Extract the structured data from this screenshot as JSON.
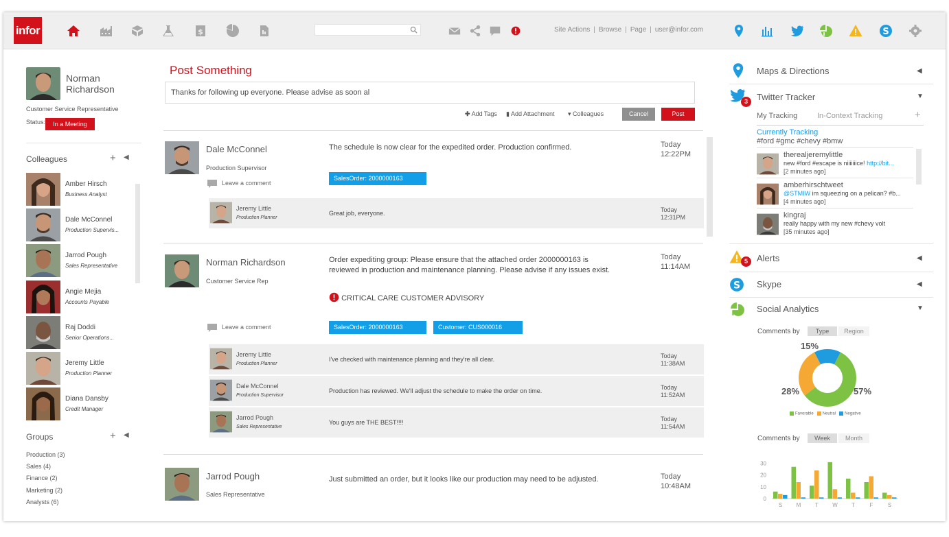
{
  "app": {
    "logo": "infor"
  },
  "topbar": {
    "search": {
      "value": "",
      "placeholder": ""
    },
    "site_links": [
      "Site Actions",
      "Browse",
      "Page",
      "user@infor.com"
    ]
  },
  "profile": {
    "name": "Norman Richardson",
    "title": "Customer Service Representative",
    "status_label": "Status:",
    "status": "In a Meeting"
  },
  "colleagues": {
    "title": "Colleagues",
    "items": [
      {
        "name": "Amber Hirsch",
        "role": "Business Analyst"
      },
      {
        "name": "Dale McConnel",
        "role": "Production Supervis..."
      },
      {
        "name": "Jarrod Pough",
        "role": "Sales Representative"
      },
      {
        "name": "Angie Mejia",
        "role": "Accounts Payable"
      },
      {
        "name": "Raj Doddi",
        "role": "Senior Operations..."
      },
      {
        "name": "Jeremy Little",
        "role": "Production Planner"
      },
      {
        "name": "Diana Dansby",
        "role": "Credit Manager"
      }
    ]
  },
  "groups": {
    "title": "Groups",
    "items": [
      "Production (3)",
      "Sales (4)",
      "Finance (2)",
      "Marketing (2)",
      "Analysts (6)"
    ]
  },
  "composer": {
    "title": "Post Something",
    "text": "Thanks for following up everyone. Please advise as soon al",
    "add_tags": "Add Tags",
    "add_attachment": "Add Attachment",
    "colleagues": "Colleagues",
    "cancel": "Cancel",
    "post": "Post"
  },
  "posts": [
    {
      "name": "Dale McConnel",
      "role": "Production Supervisor",
      "body": "The schedule is now clear for the expedited order. Production confirmed.",
      "day": "Today",
      "time": "12:22PM",
      "comment": "Leave a comment",
      "tags": [
        "SalesOrder: 2000000163"
      ],
      "replies": [
        {
          "name": "Jeremy Little",
          "role": "Production Planner",
          "text": "Great job, everyone.",
          "day": "Today",
          "time": "12:31PM"
        }
      ]
    },
    {
      "name": "Norman Richardson",
      "role": "Customer Service Rep",
      "body": "Order expediting group: Please ensure that the attached order 2000000163 is reviewed in production and maintenance planning. Please advise if any issues exist.",
      "critical": "CRITICAL CARE CUSTOMER ADVISORY",
      "day": "Today",
      "time": "11:14AM",
      "comment": "Leave a comment",
      "tags": [
        "SalesOrder: 2000000163",
        "Customer: CUS000016"
      ],
      "replies": [
        {
          "name": "Jeremy Little",
          "role": "Production Planner",
          "text": "I've checked with maintenance planning and they're all clear.",
          "day": "Today",
          "time": "11:38AM"
        },
        {
          "name": "Dale McConnel",
          "role": "Production Supervisor",
          "text": "Production has reviewed. We'll adjust the schedule to make the order on time.",
          "day": "Today",
          "time": "11:52AM"
        },
        {
          "name": "Jarrod Pough",
          "role": "Sales Representative",
          "text": "You guys are THE BEST!!!!",
          "day": "Today",
          "time": "11:54AM"
        }
      ]
    },
    {
      "name": "Jarrod Pough",
      "role": "Sales Representative",
      "body": "Just submitted an order, but it looks like our production may need to be adjusted.",
      "day": "Today",
      "time": "10:48AM"
    }
  ],
  "right": {
    "maps": "Maps & Directions",
    "twitter": {
      "title": "Twitter Tracker",
      "badge": "3",
      "tab_active": "My Tracking",
      "tab_other": "In-Context Tracking",
      "currently": "Currently Tracking",
      "hashtags": "#ford  #gmc  #chevy  #bmw",
      "tweets": [
        {
          "user": "therealjeremylittle",
          "text": "new #ford #escape is niiiiiiice!",
          "link": "http://bit...",
          "ago": "[2 minutes ago]"
        },
        {
          "user": "amberhirschtweet",
          "mention": "@STMIW",
          "text": " im squeezing on a pelican? #b...",
          "ago": "[4 minutes ago]"
        },
        {
          "user": "kingraj",
          "text": "really happy with my new #chevy volt",
          "ago": "[35 minutes ago]"
        }
      ]
    },
    "alerts": {
      "title": "Alerts",
      "badge": "5"
    },
    "skype": "Skype",
    "social": {
      "title": "Social Analytics",
      "comments_by": "Comments by",
      "type": "Type",
      "region": "Region",
      "week": "Week",
      "month": "Month"
    }
  },
  "chart_data": [
    {
      "type": "pie",
      "title": "",
      "categories": [
        "Favorable",
        "Neutral",
        "Negative"
      ],
      "values": [
        57,
        28,
        15
      ],
      "labels": [
        "57%",
        "28%",
        "15%"
      ],
      "colors": [
        "#7dc243",
        "#f5a833",
        "#1f9be0"
      ]
    },
    {
      "type": "bar",
      "title": "",
      "categories": [
        "S",
        "M",
        "T",
        "W",
        "T",
        "F",
        "S"
      ],
      "series": [
        {
          "values": [
            6,
            27,
            11,
            31,
            17,
            14,
            5
          ],
          "color": "#7dc243"
        },
        {
          "values": [
            4,
            14,
            24,
            8,
            5,
            19,
            3
          ],
          "color": "#f5a833"
        },
        {
          "values": [
            3,
            1,
            1,
            1,
            1,
            1,
            1
          ],
          "color": "#1f9be0"
        }
      ],
      "yticks": [
        "0",
        "10",
        "20",
        "30"
      ],
      "ylim": [
        0,
        35
      ]
    }
  ]
}
